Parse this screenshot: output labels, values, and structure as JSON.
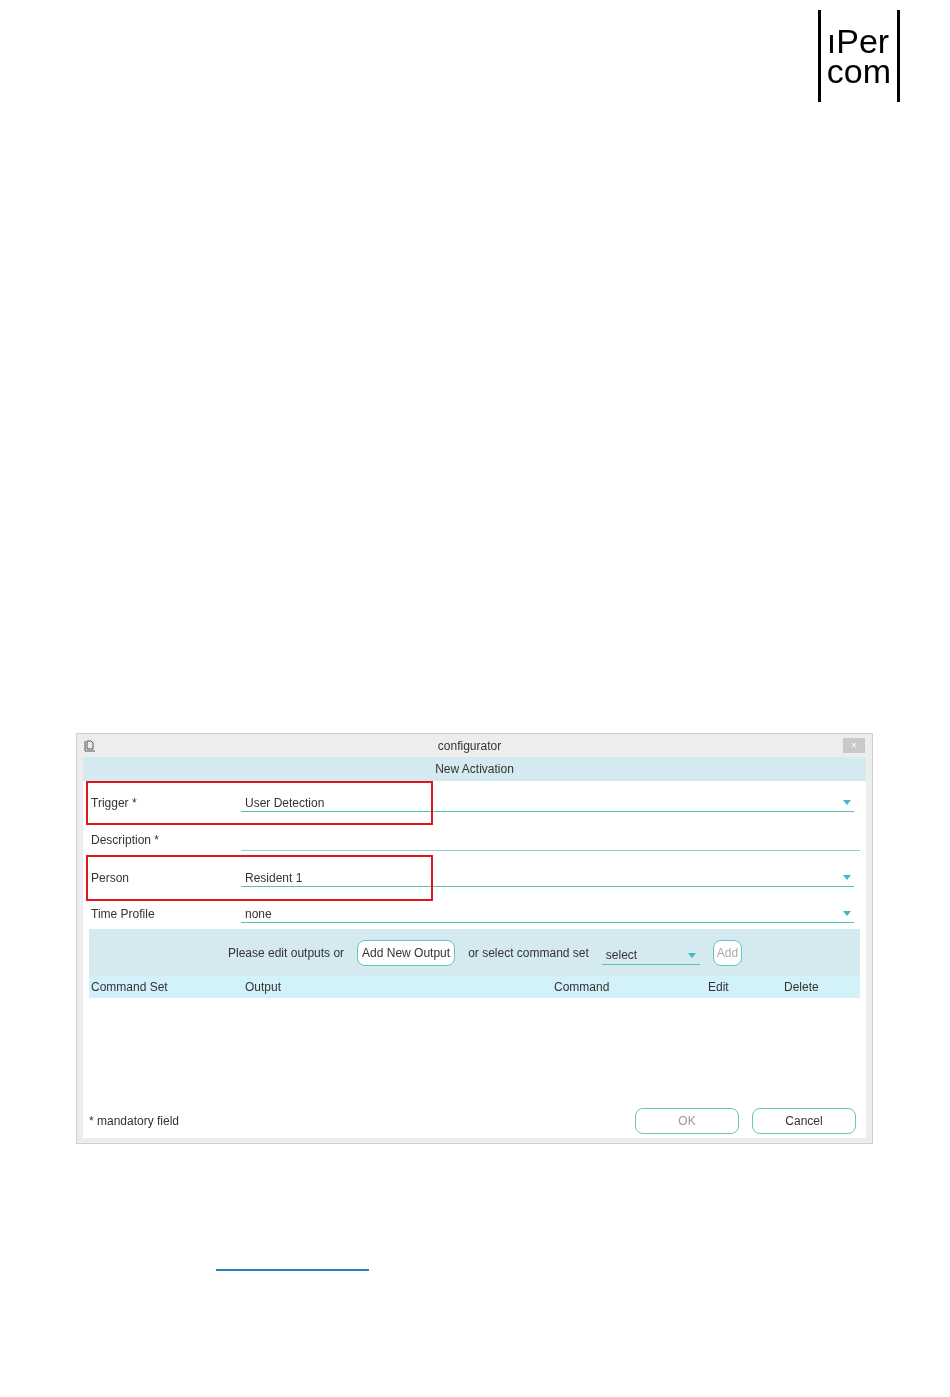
{
  "logo": {
    "line_1": "ıPer",
    "line_2": "com"
  },
  "window": {
    "title": "configurator",
    "close": "×"
  },
  "dialog": {
    "heading": "New Activation",
    "fields": [
      {
        "label": "Trigger *",
        "value": "User Detection",
        "kind": "dropdown",
        "highlighted": true
      },
      {
        "label": "Description *",
        "kind": "text",
        "highlighted": false
      },
      {
        "label": "Person",
        "value": "Resident 1",
        "kind": "dropdown",
        "highlighted": true
      },
      {
        "label": "Time Profile",
        "value": "none",
        "kind": "dropdown",
        "highlighted": false
      }
    ],
    "outputs_bar": {
      "prompt": "Please edit outputs or",
      "add_new_output": "Add New Output",
      "select_prompt": "or select command set",
      "select_value": "select",
      "add": "Add"
    },
    "table": {
      "columns": [
        "Command Set",
        "Output",
        "Command",
        "Edit",
        "Delete"
      ]
    },
    "footnote": "* mandatory field",
    "buttons": [
      {
        "label": "OK",
        "disabled": true
      },
      {
        "label": "Cancel",
        "disabled": false
      }
    ]
  }
}
